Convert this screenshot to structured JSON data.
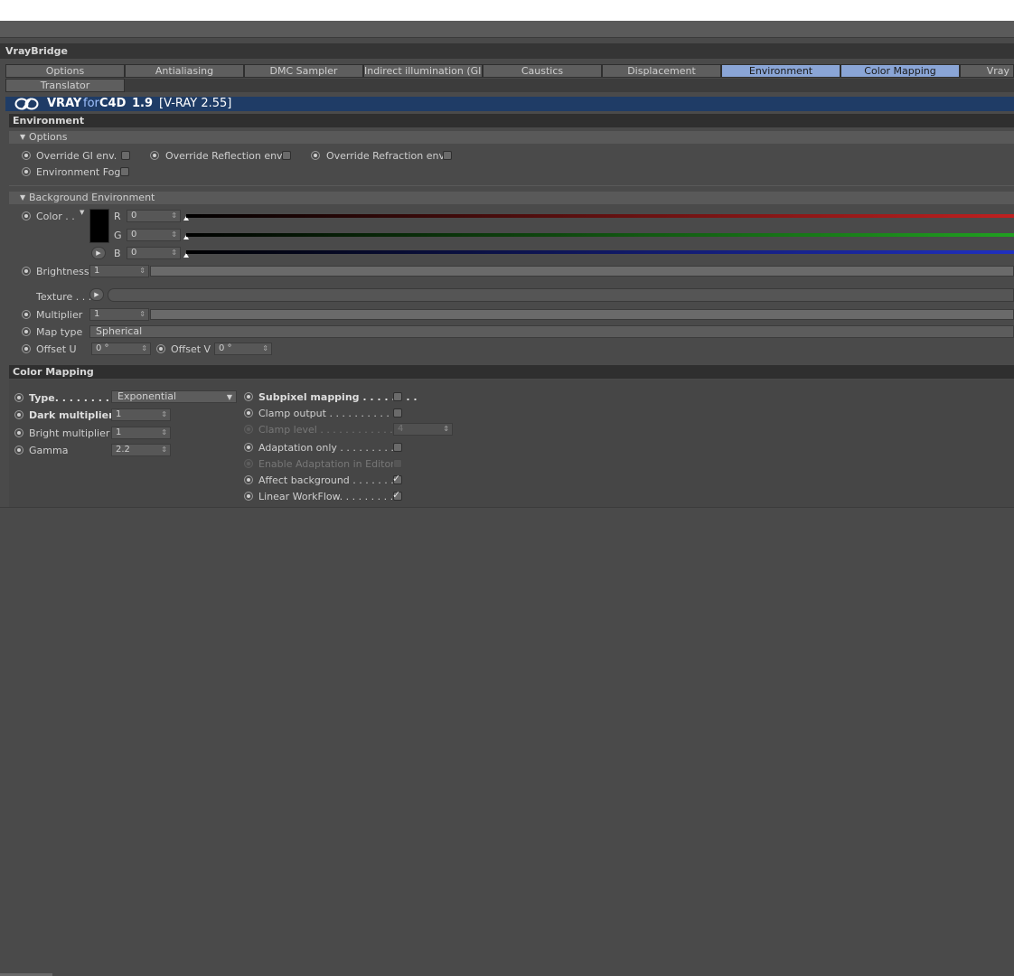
{
  "window": {
    "title": "VrayBridge"
  },
  "tabs": [
    {
      "label": "Options",
      "active": false
    },
    {
      "label": "Antialiasing",
      "active": false
    },
    {
      "label": "DMC Sampler",
      "active": false
    },
    {
      "label": "Indirect illumination (GI)",
      "active": false
    },
    {
      "label": "Caustics",
      "active": false
    },
    {
      "label": "Displacement",
      "active": false
    },
    {
      "label": "Environment",
      "active": true
    },
    {
      "label": "Color Mapping",
      "active": true
    },
    {
      "label": "Vray",
      "active": false
    },
    {
      "label": "Translator",
      "active": false
    }
  ],
  "banner": {
    "logo_a": "VRAY",
    "logo_b": "for",
    "logo_c": "C4D",
    "version": "1.9",
    "vray_version": "[V-RAY 2.55]"
  },
  "environment": {
    "section_title": "Environment",
    "options": {
      "title": "Options",
      "override_gi": "Override GI env.",
      "override_reflection": "Override Reflection env.",
      "override_refraction": "Override Refraction env.",
      "environment_fog": "Environment Fog"
    },
    "background": {
      "title": "Background Environment",
      "color_label": "Color . .",
      "r_label": "R",
      "r_value": "0",
      "g_label": "G",
      "g_value": "0",
      "b_label": "B",
      "b_value": "0",
      "brightness_label": "Brightness",
      "brightness_value": "1",
      "texture_label": "Texture . . .",
      "multiplier_label": "Multiplier",
      "multiplier_value": "1",
      "map_type_label": "Map type",
      "map_type_value": "Spherical",
      "offset_u_label": "Offset U",
      "offset_u_value": "0 °",
      "offset_v_label": "Offset V",
      "offset_v_value": "0 °",
      "color_swatch": "#000000"
    }
  },
  "color_mapping": {
    "section_title": "Color Mapping",
    "type_label": "Type. . . . . . . . . .",
    "type_value": "Exponential",
    "dark_multiplier_label": "Dark multiplier",
    "dark_multiplier_value": "1",
    "bright_multiplier_label": "Bright multiplier",
    "bright_multiplier_value": "1",
    "gamma_label": "Gamma",
    "gamma_value": "2.2",
    "subpixel_mapping_label": "Subpixel mapping . . . . . . . .",
    "clamp_output_label": "Clamp output . . . . . . . . . . . .",
    "clamp_level_label": "Clamp level . . . . . . . . . . . . . .",
    "clamp_level_value": "4",
    "adaptation_only_label": "Adaptation only . . . . . . . . . .",
    "enable_adaptation_label": "Enable Adaptation in Editor",
    "affect_background_label": "Affect background . . . . . . . .",
    "linear_workflow_label": "Linear WorkFlow. . . . . . . . .",
    "affect_background_checked": true,
    "linear_workflow_checked": true
  },
  "colors": {
    "active_tab": "#8aa5d6",
    "banner": "#1f3c66",
    "red_channel": "#c02020",
    "green_channel": "#20a020",
    "blue_channel": "#2030c0"
  }
}
